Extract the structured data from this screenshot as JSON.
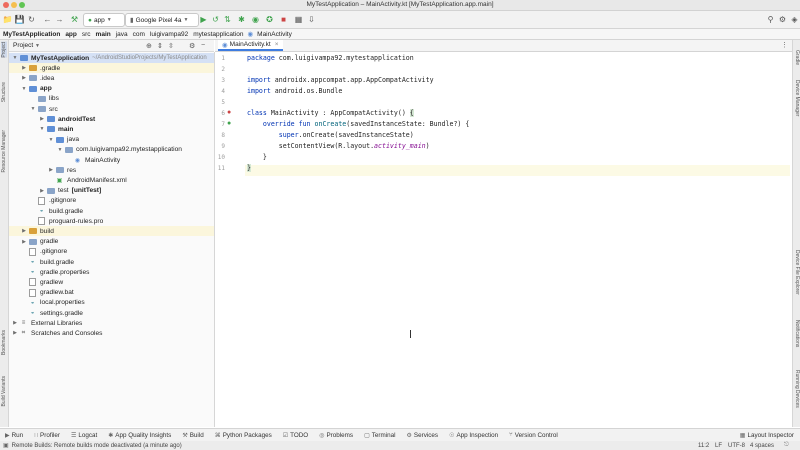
{
  "window": {
    "title": "MyTestApplication – MainActivity.kt [MyTestApplication.app.main]"
  },
  "toolbar": {
    "module": "app",
    "device": "Google Pixel 4a"
  },
  "breadcrumbs": [
    "MyTestApplication",
    "app",
    "src",
    "main",
    "java",
    "com",
    "luigivampa92",
    "mytestapplication",
    "MainActivity"
  ],
  "project_panel": {
    "view_label": "Project",
    "items": [
      {
        "depth": 0,
        "arrow": "open",
        "icon": "folder-blue",
        "label": "MyTestApplication",
        "suffix": "~/AndroidStudioProjects/MyTestApplication",
        "bold": true,
        "state": "selected"
      },
      {
        "depth": 1,
        "arrow": "closed",
        "icon": "folder-orange",
        "label": ".gradle",
        "state": "highlight"
      },
      {
        "depth": 1,
        "arrow": "closed",
        "icon": "folder",
        "label": ".idea"
      },
      {
        "depth": 1,
        "arrow": "open",
        "icon": "folder-blue",
        "label": "app",
        "bold": true
      },
      {
        "depth": 2,
        "arrow": "none",
        "icon": "folder",
        "label": "libs"
      },
      {
        "depth": 2,
        "arrow": "open",
        "icon": "folder",
        "label": "src"
      },
      {
        "depth": 3,
        "arrow": "closed",
        "icon": "folder-blue",
        "label": "androidTest",
        "bold": true
      },
      {
        "depth": 3,
        "arrow": "open",
        "icon": "folder-blue",
        "label": "main",
        "bold": true
      },
      {
        "depth": 4,
        "arrow": "open",
        "icon": "folder-blue",
        "label": "java"
      },
      {
        "depth": 5,
        "arrow": "open",
        "icon": "folder",
        "label": "com.luigivampa92.mytestapplication"
      },
      {
        "depth": 6,
        "arrow": "none",
        "icon": "kotlin",
        "label": "MainActivity"
      },
      {
        "depth": 4,
        "arrow": "closed",
        "icon": "folder",
        "label": "res"
      },
      {
        "depth": 4,
        "arrow": "none",
        "icon": "manifest",
        "label": "AndroidManifest.xml"
      },
      {
        "depth": 3,
        "arrow": "closed",
        "icon": "folder",
        "label": "test",
        "suffix": "[unitTest]",
        "suffix_bold": true
      },
      {
        "depth": 2,
        "arrow": "none",
        "icon": "file",
        "label": ".gitignore"
      },
      {
        "depth": 2,
        "arrow": "none",
        "icon": "gradle",
        "label": "build.gradle"
      },
      {
        "depth": 2,
        "arrow": "none",
        "icon": "file",
        "label": "proguard-rules.pro"
      },
      {
        "depth": 1,
        "arrow": "closed",
        "icon": "folder-orange",
        "label": "build",
        "state": "highlight"
      },
      {
        "depth": 1,
        "arrow": "closed",
        "icon": "folder",
        "label": "gradle"
      },
      {
        "depth": 1,
        "arrow": "none",
        "icon": "file",
        "label": ".gitignore"
      },
      {
        "depth": 1,
        "arrow": "none",
        "icon": "gradle",
        "label": "build.gradle"
      },
      {
        "depth": 1,
        "arrow": "none",
        "icon": "gradle",
        "label": "gradle.properties"
      },
      {
        "depth": 1,
        "arrow": "none",
        "icon": "file",
        "label": "gradlew"
      },
      {
        "depth": 1,
        "arrow": "none",
        "icon": "file",
        "label": "gradlew.bat"
      },
      {
        "depth": 1,
        "arrow": "none",
        "icon": "gradle",
        "label": "local.properties"
      },
      {
        "depth": 1,
        "arrow": "none",
        "icon": "gradle",
        "label": "settings.gradle"
      },
      {
        "depth": 0,
        "arrow": "closed",
        "icon": "library",
        "label": "External Libraries"
      },
      {
        "depth": 0,
        "arrow": "closed",
        "icon": "scratch",
        "label": "Scratches and Consoles"
      }
    ]
  },
  "editor": {
    "tab_label": "MainActivity.kt",
    "line_numbers": [
      "1",
      "2",
      "3",
      "4",
      "5",
      "6",
      "7",
      "8",
      "9",
      "10",
      "11"
    ]
  },
  "left_strip": [
    "Project",
    "Structure",
    "Resource Manager",
    "Bookmarks",
    "Build Variants"
  ],
  "right_strip": [
    "Gradle",
    "Device Manager",
    "Device File Explorer",
    "Notifications",
    "Running Devices"
  ],
  "bottom_tools": [
    {
      "label": "Run",
      "icon": "run-icon"
    },
    {
      "label": "Profiler",
      "icon": "profiler-icon"
    },
    {
      "label": "Logcat",
      "icon": "logcat-icon"
    },
    {
      "label": "App Quality Insights",
      "icon": "insights-icon"
    },
    {
      "label": "Build",
      "icon": "build-icon"
    },
    {
      "label": "Python Packages",
      "icon": "python-icon"
    },
    {
      "label": "TODO",
      "icon": "todo-icon"
    },
    {
      "label": "Problems",
      "icon": "problems-icon"
    },
    {
      "label": "Terminal",
      "icon": "terminal-icon"
    },
    {
      "label": "Services",
      "icon": "services-icon"
    },
    {
      "label": "App Inspection",
      "icon": "inspection-icon"
    },
    {
      "label": "Version Control",
      "icon": "vcs-icon"
    }
  ],
  "layout_inspector_label": "Layout Inspector",
  "status": {
    "message": "Remote Builds: Remote builds mode deactivated (a minute ago)",
    "position": "11:2",
    "line_sep": "LF",
    "encoding": "UTF-8",
    "indent": "4 spaces"
  },
  "colors": {
    "accent": "#3e7ce0",
    "run_green": "#3fa34d",
    "keyword": "#0033b3",
    "string": "#067d17",
    "folder_orange": "#d9a13a"
  }
}
